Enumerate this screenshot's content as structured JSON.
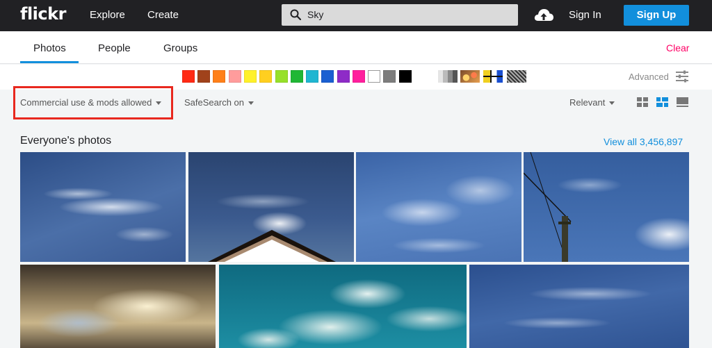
{
  "header": {
    "logo": "flickr",
    "nav": [
      "Explore",
      "Create"
    ],
    "search_value": "Sky",
    "sign_in": "Sign In",
    "sign_up": "Sign Up"
  },
  "tabs": {
    "items": [
      "Photos",
      "People",
      "Groups"
    ],
    "active": "Photos",
    "clear": "Clear"
  },
  "colors": {
    "swatches": [
      "#ff2a14",
      "#a0421b",
      "#ff8019",
      "#ff9c9c",
      "#fff12a",
      "#ffcf20",
      "#97e02a",
      "#20b735",
      "#1fb6d1",
      "#1a5fd1",
      "#8e2bc7",
      "#ff1f9d",
      "#ffffff",
      "#7d7d7d",
      "#000000"
    ],
    "styles": [
      "black-and-white-icon",
      "shallow-depth-of-field-icon",
      "minimalism-icon",
      "patterns-icon"
    ],
    "advanced": "Advanced"
  },
  "filters": {
    "license": "Commercial use & mods allowed",
    "safesearch": "SafeSearch on",
    "sort": "Relevant"
  },
  "section": {
    "title": "Everyone's photos",
    "view_all": "View all 3,456,897"
  },
  "brand": {
    "accent": "#128fdc",
    "clear": "#ff0065",
    "highlight": "#e8281e"
  }
}
